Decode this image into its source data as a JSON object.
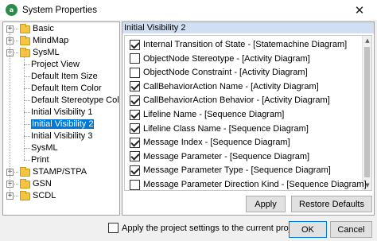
{
  "window": {
    "title": "System Properties",
    "app_icon_text": "a",
    "close_glyph": "✕"
  },
  "tree": {
    "expander_plus": "+",
    "expander_minus": "−",
    "items": [
      {
        "label": "Basic",
        "type": "folder",
        "expanded": false
      },
      {
        "label": "MindMap",
        "type": "folder",
        "expanded": false
      },
      {
        "label": "SysML",
        "type": "folder",
        "expanded": true
      },
      {
        "label": "Project View",
        "type": "child"
      },
      {
        "label": "Default Item Size",
        "type": "child"
      },
      {
        "label": "Default Item Color",
        "type": "child"
      },
      {
        "label": "Default Stereotype Color",
        "type": "child"
      },
      {
        "label": "Initial Visibility 1",
        "type": "child"
      },
      {
        "label": "Initial Visibility 2",
        "type": "child",
        "selected": true
      },
      {
        "label": "Initial Visibility 3",
        "type": "child"
      },
      {
        "label": "SysML",
        "type": "child"
      },
      {
        "label": "Print",
        "type": "child"
      },
      {
        "label": "STAMP/STPA",
        "type": "folder",
        "expanded": false
      },
      {
        "label": "GSN",
        "type": "folder",
        "expanded": false
      },
      {
        "label": "SCDL",
        "type": "folder",
        "expanded": false
      }
    ]
  },
  "panel": {
    "header": "Initial Visibility 2",
    "options": [
      {
        "label": "Internal Transition of State - [Statemachine Diagram]",
        "checked": true
      },
      {
        "label": "ObjectNode Stereotype - [Activity Diagram]",
        "checked": false
      },
      {
        "label": "ObjectNode Constraint - [Activity Diagram]",
        "checked": false
      },
      {
        "label": "CallBehaviorAction Name - [Activity Diagram]",
        "checked": true
      },
      {
        "label": "CallBehaviorAction Behavior - [Activity Diagram]",
        "checked": true
      },
      {
        "label": "Lifeline Name - [Sequence Diagram]",
        "checked": true
      },
      {
        "label": "Lifeline Class Name - [Sequence Diagram]",
        "checked": true
      },
      {
        "label": "Message Index - [Sequence Diagram]",
        "checked": true
      },
      {
        "label": "Message Parameter - [Sequence Diagram]",
        "checked": true
      },
      {
        "label": "Message Parameter Type - [Sequence Diagram]",
        "checked": true
      },
      {
        "label": "Message Parameter Direction Kind - [Sequence Diagram]",
        "checked": false
      }
    ],
    "scroll_up": "▲",
    "scroll_down": "▼",
    "apply_label": "Apply",
    "restore_label": "Restore Defaults"
  },
  "footer": {
    "apply_project_label": "Apply the project settings to the current project",
    "apply_project_checked": false,
    "ok_label": "OK",
    "cancel_label": "Cancel"
  }
}
